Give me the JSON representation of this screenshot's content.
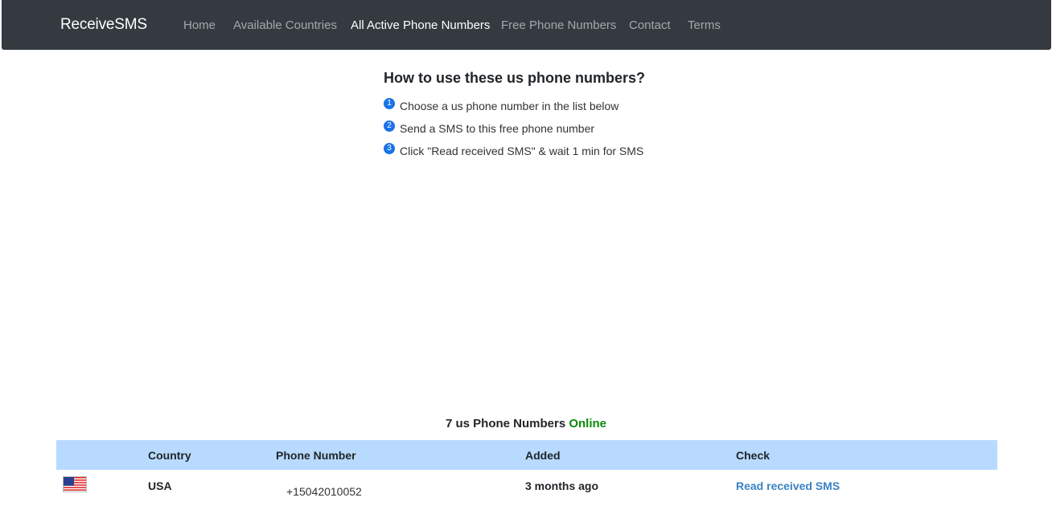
{
  "nav": {
    "brand": "ReceiveSMS",
    "items": [
      {
        "label": "Home",
        "active": false
      },
      {
        "label": "Available Countries",
        "active": false
      },
      {
        "label": "All Active Phone Numbers",
        "active": true
      },
      {
        "label": "Free Phone Numbers",
        "active": false
      },
      {
        "label": "Contact",
        "active": false
      },
      {
        "label": "Terms",
        "active": false
      }
    ]
  },
  "howto": {
    "title": "How to use these us phone numbers?",
    "steps": [
      {
        "num": "1",
        "text": "Choose a us phone number in the list below"
      },
      {
        "num": "2",
        "text": "Send a SMS to this free phone number"
      },
      {
        "num": "3",
        "text": "Click \"Read received SMS\" & wait 1 min for SMS"
      }
    ]
  },
  "summary": {
    "count_text": "7 us Phone Numbers",
    "status": "Online",
    "status_color": "#0a8a0a"
  },
  "table": {
    "headers": {
      "country": "Country",
      "phone": "Phone Number",
      "added": "Added",
      "check": "Check"
    },
    "rows": [
      {
        "flag_icon": "us-flag-icon",
        "country": "USA",
        "phone": "+15042010052",
        "added": "3 months ago",
        "check": "Read received SMS"
      }
    ]
  },
  "colors": {
    "navbar": "#343a40",
    "table_header": "#b8daff",
    "link": "#3b82c4",
    "step_badge": "#1a73e8"
  }
}
